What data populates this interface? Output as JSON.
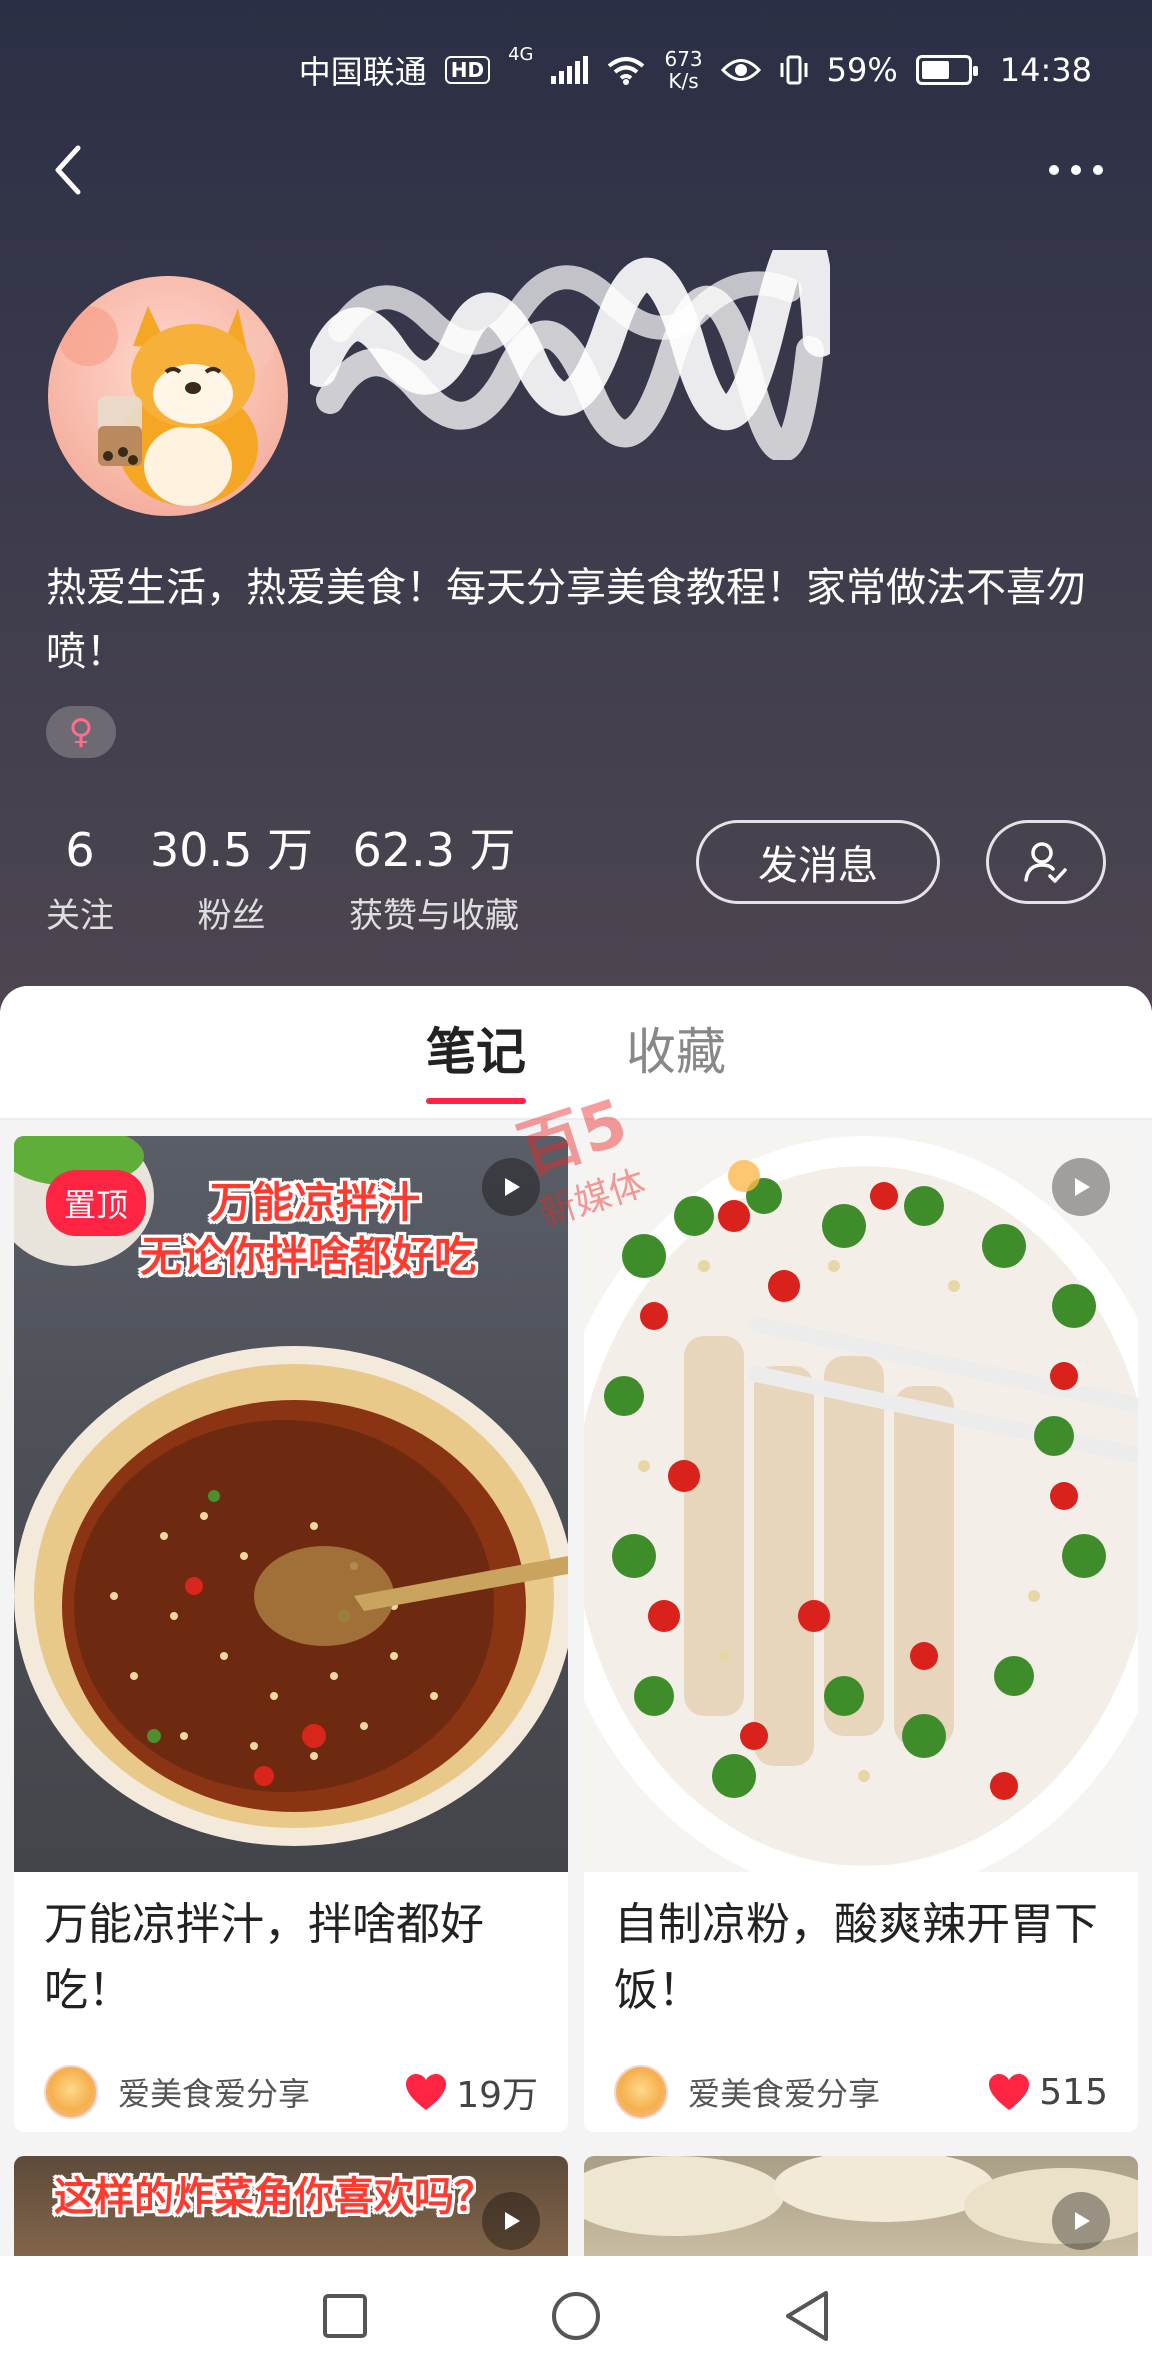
{
  "status_bar": {
    "carrier": "中国联通",
    "hd": "HD",
    "network": "4G",
    "speed_value": "673",
    "speed_unit": "K/s",
    "battery": "59%",
    "time": "14:38"
  },
  "profile": {
    "bio": "热爱生活，热爱美食！每天分享美食教程！家常做法不喜勿喷！",
    "gender_symbol": "♀",
    "stats": [
      {
        "value": "6",
        "label": "关注"
      },
      {
        "value": "30.5 万",
        "label": "粉丝"
      },
      {
        "value": "62.3 万",
        "label": "获赞与收藏"
      }
    ],
    "message_button": "发消息"
  },
  "tabs": [
    {
      "label": "笔记",
      "active": true
    },
    {
      "label": "收藏",
      "active": false
    }
  ],
  "watermark": {
    "logo": "百5",
    "text": "新媒体"
  },
  "notes": [
    {
      "pin_label": "置顶",
      "cover_text_1": "万能凉拌汁",
      "cover_text_2": "无论你拌啥都好吃",
      "title": "万能凉拌汁，拌啥都好吃！",
      "author": "爱美食爱分享",
      "likes": "19万"
    },
    {
      "title": "自制凉粉，酸爽辣开胃下饭！",
      "author": "爱美食爱分享",
      "likes": "515"
    },
    {
      "cover_text_1": "这样的炸菜角你喜欢吗？"
    },
    {}
  ],
  "colors": {
    "accent": "#ff2442",
    "header_bg": "#34334a"
  }
}
